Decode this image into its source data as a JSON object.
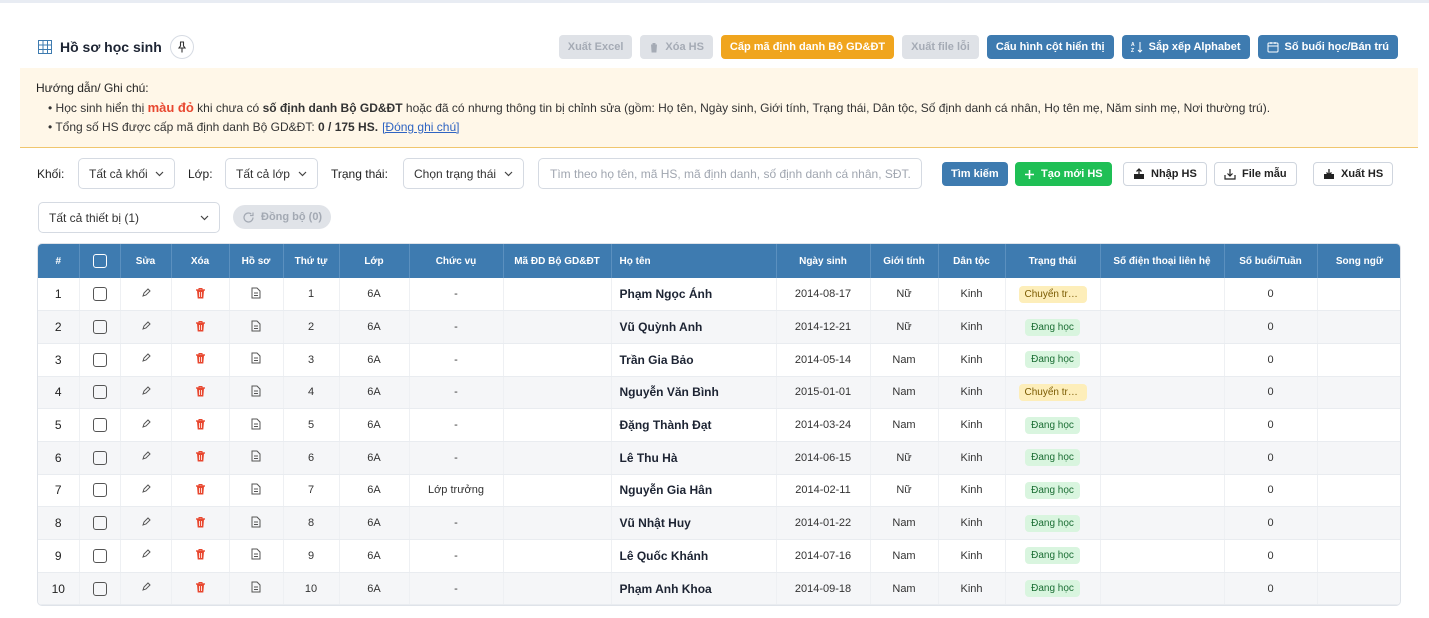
{
  "header": {
    "title": "Hồ sơ học sinh",
    "actions": {
      "export_excel": "Xuất Excel",
      "delete_hs": "Xóa HS",
      "grant_id": "Cấp mã định danh Bộ GD&ĐT",
      "export_error": "Xuất file lỗi",
      "config_columns": "Cấu hình cột hiển thị",
      "sort_alpha": "Sắp xếp Alphabet",
      "sessions": "Số buổi học/Bán trú"
    }
  },
  "notice": {
    "heading": "Hướng dẫn/ Ghi chú:",
    "line1_a": "• Học sinh hiển thị ",
    "line1_red": "màu đỏ",
    "line1_b": " khi chưa có ",
    "line1_bold": "số định danh Bộ GD&ĐT",
    "line1_c": " hoặc đã có nhưng thông tin bị chỉnh sửa (gồm: Họ tên, Ngày sinh, Giới tính, Trạng thái, Dân tộc, Số định danh cá nhân, Họ tên mẹ, Năm sinh mẹ, Nơi thường trú).",
    "line2_a": "• Tổng số HS được cấp mã định danh Bộ GD&ĐT: ",
    "line2_bold": "0 / 175 HS.",
    "close_link": "[Đóng ghi chú]"
  },
  "filters": {
    "grade_label": "Khối:",
    "grade_value": "Tất cả khối",
    "class_label": "Lớp:",
    "class_value": "Tất cả lớp",
    "status_label": "Trạng thái:",
    "status_value": "Chọn trạng thái",
    "search_placeholder": "Tìm theo họ tên, mã HS, mã định danh, số định danh cá nhân, SĐT...",
    "search_button": "Tìm kiếm",
    "create_button": "Tạo mới HS",
    "import_button": "Nhập HS",
    "template_button": "File mẫu",
    "export_button": "Xuất HS",
    "device_value": "Tất cả thiết bị (1)",
    "sync_button": "Đồng bộ (0)"
  },
  "table": {
    "columns": [
      "#",
      "",
      "Sửa",
      "Xóa",
      "Hồ sơ",
      "Thứ tự",
      "Lớp",
      "Chức vụ",
      "Mã ĐD Bộ GD&ĐT",
      "Họ tên",
      "Ngày sinh",
      "Giới tính",
      "Dân tộc",
      "Trạng thái",
      "Số điện thoại liên hệ",
      "Số buổi/Tuần",
      "Song ngữ"
    ],
    "rows": [
      {
        "idx": "1",
        "order": "1",
        "class": "6A",
        "role": "-",
        "code": "",
        "name": "Phạm Ngọc Ánh",
        "dob": "2014-08-17",
        "gender": "Nữ",
        "ethnic": "Kinh",
        "status": "Chuyển trường",
        "status_color": "yellow",
        "phone": "",
        "sessions": "0",
        "bilingual": ""
      },
      {
        "idx": "2",
        "order": "2",
        "class": "6A",
        "role": "-",
        "code": "",
        "name": "Vũ Quỳnh Anh",
        "dob": "2014-12-21",
        "gender": "Nữ",
        "ethnic": "Kinh",
        "status": "Đang học",
        "status_color": "green",
        "phone": "",
        "sessions": "0",
        "bilingual": ""
      },
      {
        "idx": "3",
        "order": "3",
        "class": "6A",
        "role": "-",
        "code": "",
        "name": "Trần Gia Bảo",
        "dob": "2014-05-14",
        "gender": "Nam",
        "ethnic": "Kinh",
        "status": "Đang học",
        "status_color": "green",
        "phone": "",
        "sessions": "0",
        "bilingual": ""
      },
      {
        "idx": "4",
        "order": "4",
        "class": "6A",
        "role": "-",
        "code": "",
        "name": "Nguyễn Văn Bình",
        "dob": "2015-01-01",
        "gender": "Nam",
        "ethnic": "Kinh",
        "status": "Chuyển trường",
        "status_color": "yellow",
        "phone": "",
        "sessions": "0",
        "bilingual": ""
      },
      {
        "idx": "5",
        "order": "5",
        "class": "6A",
        "role": "-",
        "code": "",
        "name": "Đặng Thành Đạt",
        "dob": "2014-03-24",
        "gender": "Nam",
        "ethnic": "Kinh",
        "status": "Đang học",
        "status_color": "green",
        "phone": "",
        "sessions": "0",
        "bilingual": ""
      },
      {
        "idx": "6",
        "order": "6",
        "class": "6A",
        "role": "-",
        "code": "",
        "name": "Lê Thu Hà",
        "dob": "2014-06-15",
        "gender": "Nữ",
        "ethnic": "Kinh",
        "status": "Đang học",
        "status_color": "green",
        "phone": "",
        "sessions": "0",
        "bilingual": ""
      },
      {
        "idx": "7",
        "order": "7",
        "class": "6A",
        "role": "Lớp trưởng",
        "code": "",
        "name": "Nguyễn Gia Hân",
        "dob": "2014-02-11",
        "gender": "Nữ",
        "ethnic": "Kinh",
        "status": "Đang học",
        "status_color": "green",
        "phone": "",
        "sessions": "0",
        "bilingual": ""
      },
      {
        "idx": "8",
        "order": "8",
        "class": "6A",
        "role": "-",
        "code": "",
        "name": "Vũ Nhật Huy",
        "dob": "2014-01-22",
        "gender": "Nam",
        "ethnic": "Kinh",
        "status": "Đang học",
        "status_color": "green",
        "phone": "",
        "sessions": "0",
        "bilingual": ""
      },
      {
        "idx": "9",
        "order": "9",
        "class": "6A",
        "role": "-",
        "code": "",
        "name": "Lê Quốc Khánh",
        "dob": "2014-07-16",
        "gender": "Nam",
        "ethnic": "Kinh",
        "status": "Đang học",
        "status_color": "green",
        "phone": "",
        "sessions": "0",
        "bilingual": ""
      },
      {
        "idx": "10",
        "order": "10",
        "class": "6A",
        "role": "-",
        "code": "",
        "name": "Phạm Anh Khoa",
        "dob": "2014-09-18",
        "gender": "Nam",
        "ethnic": "Kinh",
        "status": "Đang học",
        "status_color": "green",
        "phone": "",
        "sessions": "0",
        "bilingual": ""
      }
    ]
  },
  "colors": {
    "primary": "#3e7bb0",
    "orange": "#f0a51e",
    "green": "#1fbf55",
    "danger": "#e8472f"
  }
}
